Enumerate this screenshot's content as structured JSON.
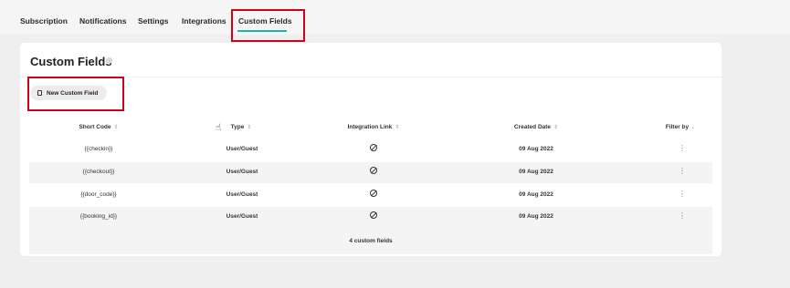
{
  "tabs": [
    {
      "label": "Subscription"
    },
    {
      "label": "Notifications"
    },
    {
      "label": "Settings"
    },
    {
      "label": "Integrations"
    },
    {
      "label": "Custom Fields",
      "active": true
    }
  ],
  "page": {
    "title": "Custom Fields",
    "new_button_label": "New Custom Field"
  },
  "table": {
    "columns": [
      {
        "label": "Short Code",
        "icon": "sort-icon"
      },
      {
        "label": "Type",
        "icon": "sort-icon"
      },
      {
        "label": "Integration Link",
        "icon": "sort-icon"
      },
      {
        "label": "Created Date",
        "icon": "sort-icon"
      },
      {
        "label": "Filter by",
        "icon": "chevron-down-icon"
      }
    ],
    "rows": [
      {
        "short_code": "{{checkin}}",
        "type": "User/Guest",
        "integration_link": "no-link-icon",
        "created_date": "09 Aug 2022"
      },
      {
        "short_code": "{{checkout}}",
        "type": "User/Guest",
        "integration_link": "no-link-icon",
        "created_date": "09 Aug 2022"
      },
      {
        "short_code": "{{door_code}}",
        "type": "User/Guest",
        "integration_link": "no-link-icon",
        "created_date": "09 Aug 2022"
      },
      {
        "short_code": "{{booking_id}}",
        "type": "User/Guest",
        "integration_link": "no-link-icon",
        "created_date": "09 Aug 2022"
      }
    ],
    "footer": "4 custom fields"
  },
  "colors": {
    "accent": "#23b5a7",
    "highlight": "#d0021b"
  }
}
